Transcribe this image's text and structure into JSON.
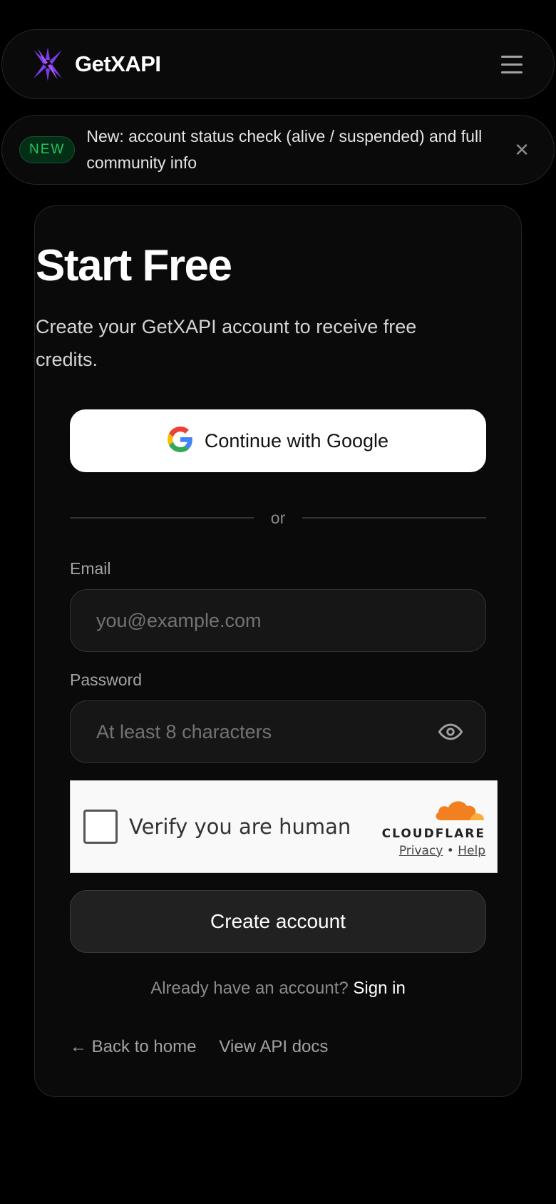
{
  "header": {
    "brand_name": "GetXAPI",
    "logo_icon": "star-burst-logo-icon",
    "menu_icon": "hamburger-menu-icon"
  },
  "banner": {
    "badge": "NEW",
    "text": "New: account status check (alive / suspended) and full community info",
    "close_icon": "close-icon"
  },
  "signup": {
    "title": "Start Free",
    "subtitle": "Create your GetXAPI account to receive free credits.",
    "google_button_label": "Continue with Google",
    "divider_text": "or",
    "email_label": "Email",
    "email_placeholder": "you@example.com",
    "email_value": "",
    "password_label": "Password",
    "password_placeholder": "At least 8 characters",
    "password_value": "",
    "create_button_label": "Create account",
    "signin_prompt": "Already have an account?",
    "signin_link": "Sign in",
    "back_home_link": "← Back to home",
    "api_docs_link": "View API docs"
  },
  "captcha": {
    "label": "Verify you are human",
    "provider": "CLOUDFLARE",
    "privacy_link": "Privacy",
    "separator": "•",
    "help_link": "Help"
  },
  "colors": {
    "background": "#000000",
    "card_background": "#0a0a0a",
    "accent_purple": "#7c3aed",
    "badge_green": "#22c55e",
    "cloudflare_orange": "#f38020"
  }
}
